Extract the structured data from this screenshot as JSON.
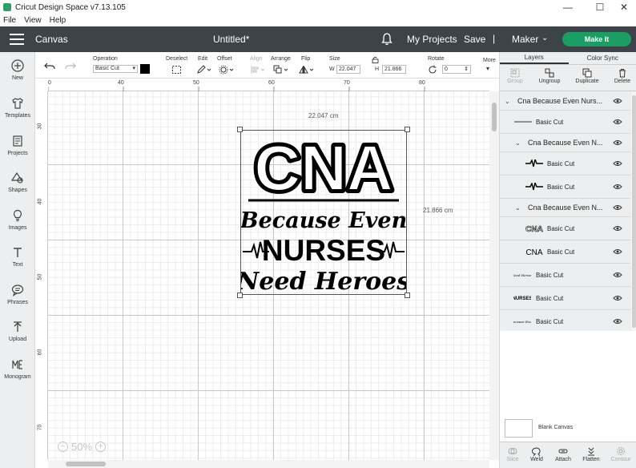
{
  "window": {
    "title": "Cricut Design Space  v7.13.105",
    "controls": {
      "minimize": "—",
      "maximize": "☐",
      "close": "✕"
    }
  },
  "menu": [
    "File",
    "View",
    "Help"
  ],
  "header": {
    "section": "Canvas",
    "doc_title": "Untitled*",
    "my_projects": "My Projects",
    "save": "Save",
    "separator": "|",
    "machine": "Maker",
    "make_it": "Make It",
    "accent_color": "#1a9e64"
  },
  "sidebar": {
    "items": [
      {
        "label": "New",
        "icon": "plus-circle-icon"
      },
      {
        "label": "Templates",
        "icon": "shirt-icon"
      },
      {
        "label": "Projects",
        "icon": "projects-icon"
      },
      {
        "label": "Shapes",
        "icon": "shapes-icon"
      },
      {
        "label": "Images",
        "icon": "lightbulb-icon"
      },
      {
        "label": "Text",
        "icon": "text-icon"
      },
      {
        "label": "Phrases",
        "icon": "speech-bubble-icon"
      },
      {
        "label": "Upload",
        "icon": "upload-icon"
      },
      {
        "label": "Monogram",
        "icon": "monogram-icon"
      }
    ]
  },
  "toolbar": {
    "operation_label": "Operation",
    "operation_value": "Basic Cut",
    "deselect": "Deselect",
    "edit": "Edit",
    "offset": "Offset",
    "align": "Align",
    "arrange": "Arrange",
    "flip": "Flip",
    "size": "Size",
    "w_label": "W",
    "w_value": "22.047",
    "h_label": "H",
    "h_value": "21.866",
    "rotate": "Rotate",
    "rotate_value": "0",
    "more": "More"
  },
  "canvas": {
    "ruler_top": [
      "0",
      "40",
      "50",
      "60",
      "70",
      "80"
    ],
    "ruler_left": [
      "30",
      "40",
      "50",
      "60",
      "70"
    ],
    "width_label": "22.047 cm",
    "height_label": "21.866 cm",
    "zoom": "50%",
    "design": {
      "line1": "CNA",
      "line2": "Because Even",
      "line3": "NURSES",
      "line4": "Need Heroes"
    }
  },
  "panel": {
    "tabs": [
      "Layers",
      "Color Sync"
    ],
    "actions": [
      "Group",
      "Ungroup",
      "Duplicate",
      "Delete"
    ],
    "layers": [
      {
        "label": "Cna Because Even Nurs...",
        "type": "group",
        "indent": 0
      },
      {
        "label": "Basic Cut",
        "thumb": "line",
        "indent": 1
      },
      {
        "label": "Cna Because Even N...",
        "type": "group",
        "indent": 1
      },
      {
        "label": "Basic Cut",
        "thumb": "heartbeat",
        "indent": 2
      },
      {
        "label": "Basic Cut",
        "thumb": "heartbeat",
        "indent": 2
      },
      {
        "label": "Cna Because Even N...",
        "type": "group",
        "indent": 1
      },
      {
        "label": "Basic Cut",
        "thumb": "CNA-outline",
        "indent": 2
      },
      {
        "label": "Basic Cut",
        "thumb": "CNA",
        "indent": 2
      },
      {
        "label": "Basic Cut",
        "thumb": "Need Heroes",
        "indent": 1
      },
      {
        "label": "Basic Cut",
        "thumb": "NURSES",
        "indent": 1
      },
      {
        "label": "Basic Cut",
        "thumb": "Because Even",
        "indent": 1
      }
    ],
    "blank_canvas": "Blank Canvas",
    "footer": [
      "Slice",
      "Weld",
      "Attach",
      "Flatten",
      "Contour"
    ]
  }
}
